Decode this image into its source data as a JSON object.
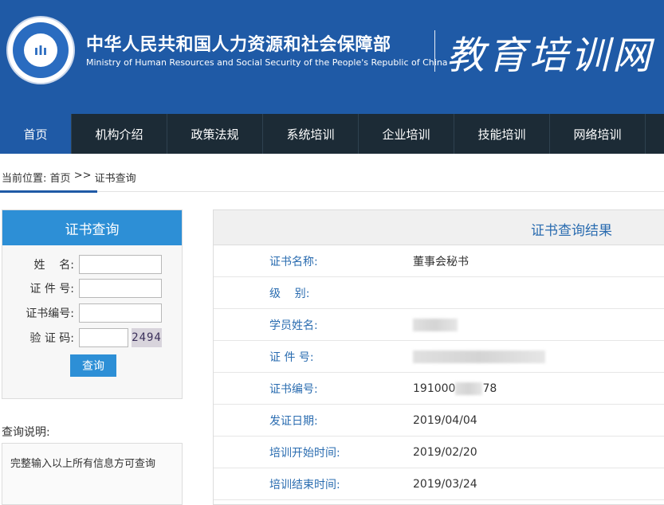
{
  "header": {
    "ministry_cn": "中华人民共和国人力资源和社会保障部",
    "ministry_en": "Ministry of Human Resources and Social Security of the People's Republic of China",
    "site_title": "教育培训网",
    "colors": {
      "bg": "#1f5aa6",
      "text": "#ffffff"
    }
  },
  "nav": {
    "items": [
      {
        "label": "首页",
        "active": true
      },
      {
        "label": "机构介绍"
      },
      {
        "label": "政策法规"
      },
      {
        "label": "系统培训"
      },
      {
        "label": "企业培训"
      },
      {
        "label": "技能培训"
      },
      {
        "label": "网络培训"
      }
    ],
    "colors": {
      "bg": "#1c2b36",
      "active": "#1f5aa6"
    }
  },
  "breadcrumb": {
    "prefix": "当前位置:",
    "home": "首页",
    "separator": ">>",
    "current": "证书查询"
  },
  "query_form": {
    "title": "证书查询",
    "fields": [
      {
        "label": "姓    名:",
        "value": ""
      },
      {
        "label": "证 件 号:",
        "value": ""
      },
      {
        "label": "证书编号:",
        "value": ""
      },
      {
        "label": "验 证 码:",
        "value": ""
      }
    ],
    "captcha_text": "2494",
    "submit_label": "查询",
    "accent": "#2d8fd6"
  },
  "notes": {
    "title": "查询说明:",
    "text": "完整输入以上所有信息方可查询"
  },
  "results": {
    "title": "证书查询结果",
    "rows": [
      {
        "label": "证书名称:",
        "value": "董事会秘书"
      },
      {
        "label": "级    别:",
        "value": ""
      },
      {
        "label": "学员姓名:",
        "value": ""
      },
      {
        "label": "证 件 号:",
        "value": ""
      },
      {
        "label": "证书编号:",
        "value_prefix": "191000",
        "value_suffix": "78"
      },
      {
        "label": "发证日期:",
        "value": "2019/04/04"
      },
      {
        "label": "培训开始时间:",
        "value": "2019/02/20"
      },
      {
        "label": "培训结束时间:",
        "value": "2019/03/24"
      }
    ],
    "label_color": "#2a6cb0"
  }
}
